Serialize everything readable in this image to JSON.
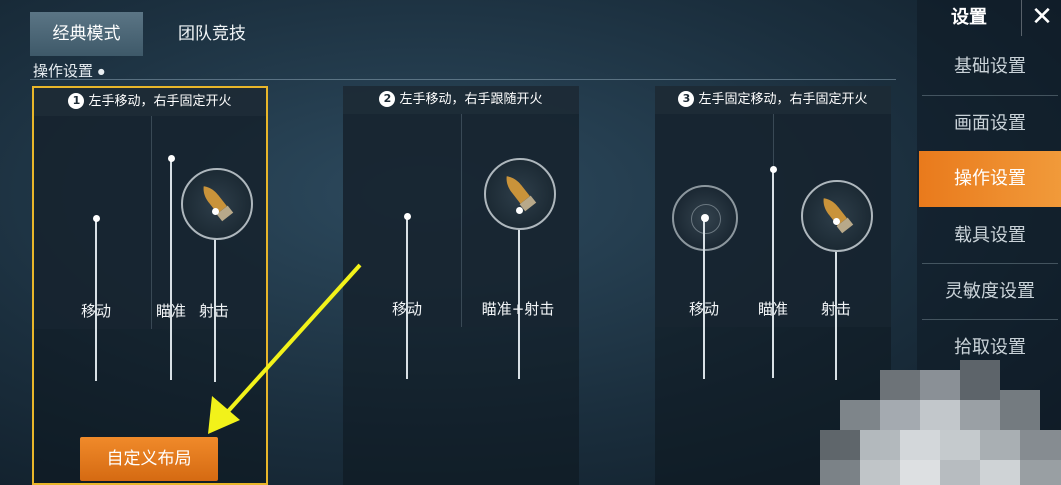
{
  "tabs": [
    {
      "label": "经典模式",
      "active": true
    },
    {
      "label": "团队竞技",
      "active": false
    }
  ],
  "section_title": "操作设置",
  "panels": [
    {
      "number": "1",
      "title": "左手移动，右手固定开火",
      "labels": [
        "移动",
        "瞄准",
        "射击"
      ],
      "selected": true
    },
    {
      "number": "2",
      "title": "左手移动，右手跟随开火",
      "labels": [
        "移动",
        "瞄准+射击"
      ],
      "selected": false
    },
    {
      "number": "3",
      "title": "左手固定移动，右手固定开火",
      "labels": [
        "移动",
        "瞄准",
        "射击"
      ],
      "selected": false
    }
  ],
  "custom_button": "自定义布局",
  "sidebar": {
    "title": "设置",
    "close_glyph": "✕",
    "items": [
      {
        "label": "基础设置",
        "active": false
      },
      {
        "label": "画面设置",
        "active": false
      },
      {
        "label": "操作设置",
        "active": true
      },
      {
        "label": "载具设置",
        "active": false
      },
      {
        "label": "灵敏度设置",
        "active": false
      },
      {
        "label": "拾取设置",
        "active": false
      }
    ]
  },
  "colors": {
    "accent_orange": "#ee8a2a",
    "selection_border": "#e8b62a",
    "annotation_arrow": "#f2f21a"
  }
}
